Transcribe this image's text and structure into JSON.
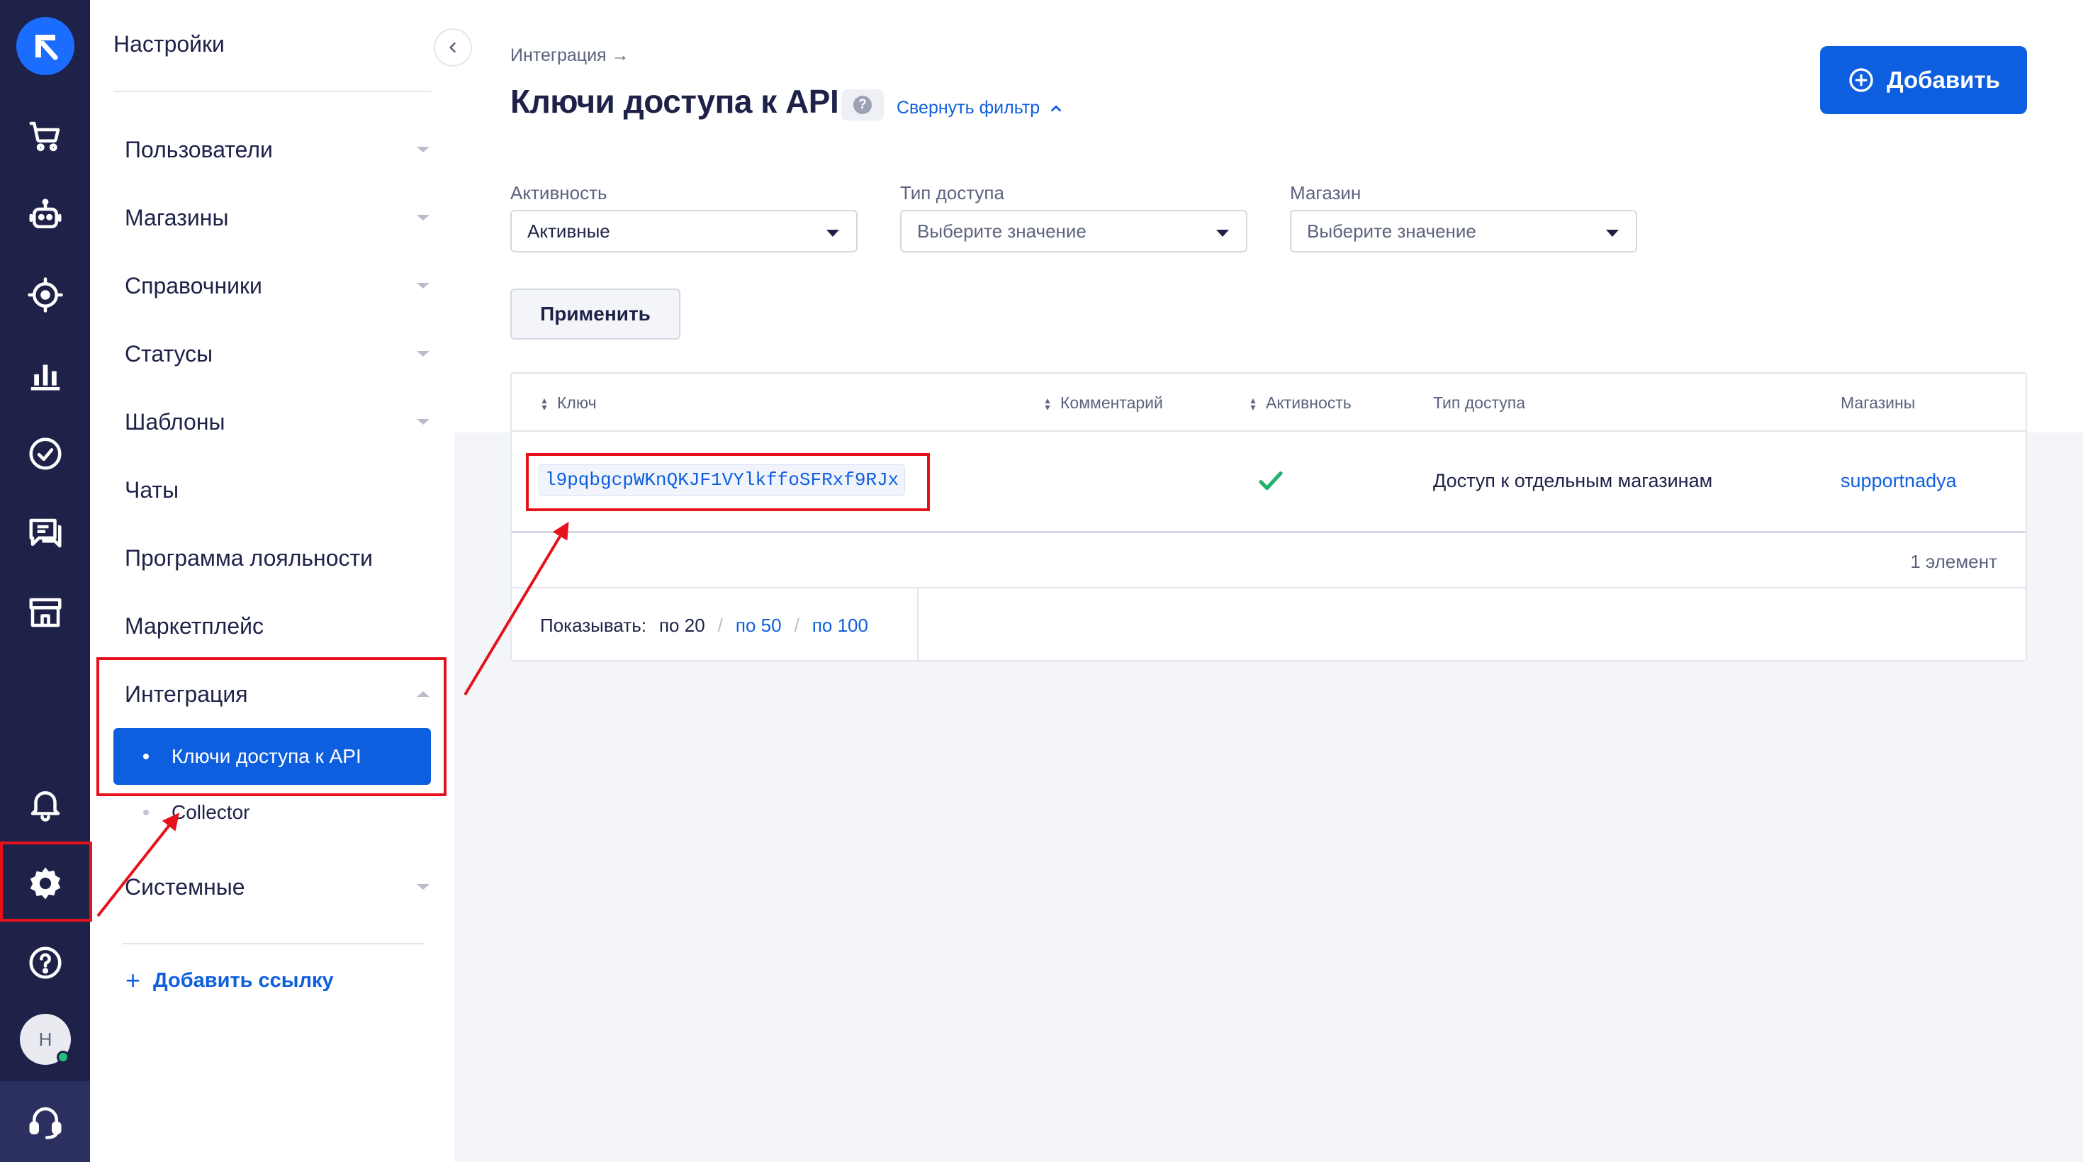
{
  "app": {
    "brand_color": "#1a6dff",
    "nav_color": "#1e2248",
    "accent": "#0e5fe0",
    "annotation_color": "#e5121c"
  },
  "rail": {
    "icons": [
      "logo-icon",
      "cart-icon",
      "robot-icon",
      "target-icon",
      "chart-icon",
      "check-circle-icon",
      "chat-icon",
      "store-icon",
      "bell-icon",
      "gear-icon",
      "help-icon",
      "headset-icon"
    ],
    "avatar_initial": "Н"
  },
  "sidebar": {
    "title": "Настройки",
    "items": [
      {
        "label": "Пользователи"
      },
      {
        "label": "Магазины"
      },
      {
        "label": "Справочники"
      },
      {
        "label": "Статусы"
      },
      {
        "label": "Шаблоны"
      },
      {
        "label": "Чаты"
      },
      {
        "label": "Программа лояльности"
      },
      {
        "label": "Маркетплейс"
      },
      {
        "label": "Интеграция"
      },
      {
        "label": "Системные"
      }
    ],
    "subitems": [
      {
        "label": "Ключи доступа к API",
        "active": true
      },
      {
        "label": "Collector",
        "active": false
      }
    ],
    "add_link": "Добавить ссылку"
  },
  "header": {
    "breadcrumb": "Интеграция →",
    "title": "Ключи доступа к API",
    "help": "?",
    "filter_toggle": "Свернуть фильтр",
    "add_button": "Добавить"
  },
  "filters": [
    {
      "label": "Активность",
      "value": "Активные"
    },
    {
      "label": "Тип доступа",
      "value": "Выберите значение"
    },
    {
      "label": "Магазин",
      "value": "Выберите значение"
    }
  ],
  "apply_button": "Применить",
  "table": {
    "columns": [
      "Ключ",
      "Комментарий",
      "Активность",
      "Тип доступа",
      "Магазины"
    ],
    "rows": [
      {
        "key": "l9pqbgcpWKnQKJF1VYlkffoSFRxf9RJx",
        "comment": "",
        "active": true,
        "access_type": "Доступ к отдельным магазинам",
        "shops": "supportnadya"
      }
    ],
    "count": "1 элемент",
    "pager": {
      "label": "Показывать:",
      "current": "по 20",
      "options": [
        "по 50",
        "по 100"
      ]
    }
  }
}
